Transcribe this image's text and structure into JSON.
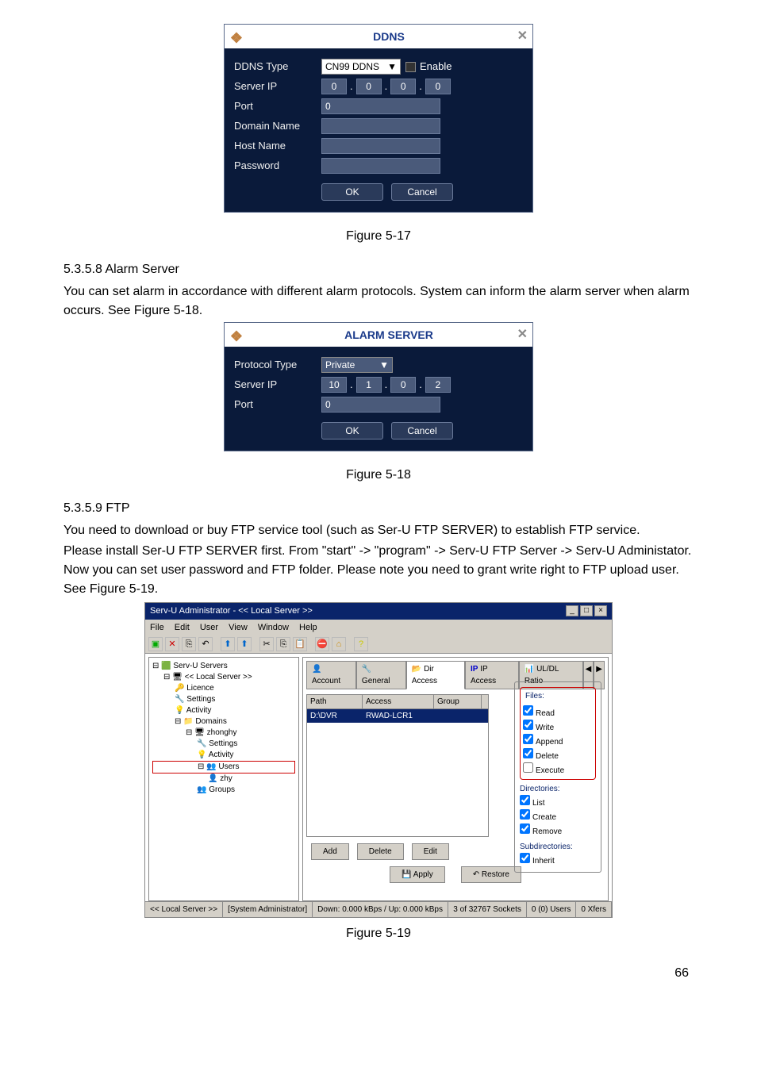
{
  "figures": {
    "fig17": "Figure 5-17",
    "fig18": "Figure 5-18",
    "fig19": "Figure 5-19"
  },
  "page_number": "66",
  "sections": {
    "alarm_heading": "5.3.5.8  Alarm Server",
    "alarm_para1": "You can set alarm in accordance with different alarm protocols. System can inform the alarm server when alarm occurs. See Figure 5-18.",
    "ftp_heading": "5.3.5.9  FTP",
    "ftp_para1": "You need to download or buy FTP service tool (such as Ser-U FTP SERVER) to establish FTP service.",
    "ftp_para2": "Please install Ser-U FTP SERVER first. From \"start\" -> \"program\" -> Serv-U FTP Server -> Serv-U Administator. Now you can set user password and FTP folder. Please note you need to grant write right to FTP upload user. See Figure 5-19."
  },
  "ddns_dialog": {
    "title": "DDNS",
    "labels": {
      "type": "DDNS Type",
      "server": "Server IP",
      "port": "Port",
      "domain": "Domain Name",
      "host": "Host Name",
      "password": "Password"
    },
    "type_value": "CN99 DDNS",
    "enable_label": "Enable",
    "ip": [
      "0",
      "0",
      "0",
      "0"
    ],
    "port_value": "0",
    "ok": "OK",
    "cancel": "Cancel"
  },
  "alarm_dialog": {
    "title": "ALARM SERVER",
    "labels": {
      "protocol": "Protocol Type",
      "server": "Server IP",
      "port": "Port"
    },
    "protocol_value": "Private",
    "ip": [
      "10",
      "1",
      "0",
      "2"
    ],
    "port_value": "0",
    "ok": "OK",
    "cancel": "Cancel"
  },
  "servu": {
    "title": "Serv-U Administrator - << Local Server >>",
    "menu": [
      "File",
      "Edit",
      "User",
      "View",
      "Window",
      "Help"
    ],
    "tree": {
      "root": "Serv-U Servers",
      "localserver": "<< Local Server >>",
      "licence": "Licence",
      "settings": "Settings",
      "activity": "Activity",
      "domains": "Domains",
      "zhonghy": "zhonghy",
      "settings2": "Settings",
      "activity2": "Activity",
      "users": "Users",
      "zhy": "zhy",
      "groups": "Groups"
    },
    "tabs": {
      "account": "Account",
      "general": "General",
      "diraccess": "Dir Access",
      "ipaccess": "IP Access",
      "uldl": "UL/DL Ratio"
    },
    "list": {
      "path_hdr": "Path",
      "access_hdr": "Access",
      "group_hdr": "Group",
      "path_val": "D:\\DVR",
      "access_val": "RWAD-LCR1"
    },
    "perms": {
      "files": "Files:",
      "read": "Read",
      "write": "Write",
      "append": "Append",
      "delete": "Delete",
      "execute": "Execute",
      "dirs": "Directories:",
      "list": "List",
      "create": "Create",
      "remove": "Remove",
      "sub": "Subdirectories:",
      "inherit": "Inherit"
    },
    "buttons": {
      "add": "Add",
      "delete": "Delete",
      "edit": "Edit",
      "apply": "Apply",
      "restore": "Restore"
    },
    "status": {
      "local": "<< Local Server >>",
      "admin": "[System Administrator]",
      "stats": "Down: 0.000 kBps / Up: 0.000 kBps",
      "sockets": "3 of 32767 Sockets",
      "users": "0 (0) Users",
      "xfers": "0 Xfers"
    }
  }
}
